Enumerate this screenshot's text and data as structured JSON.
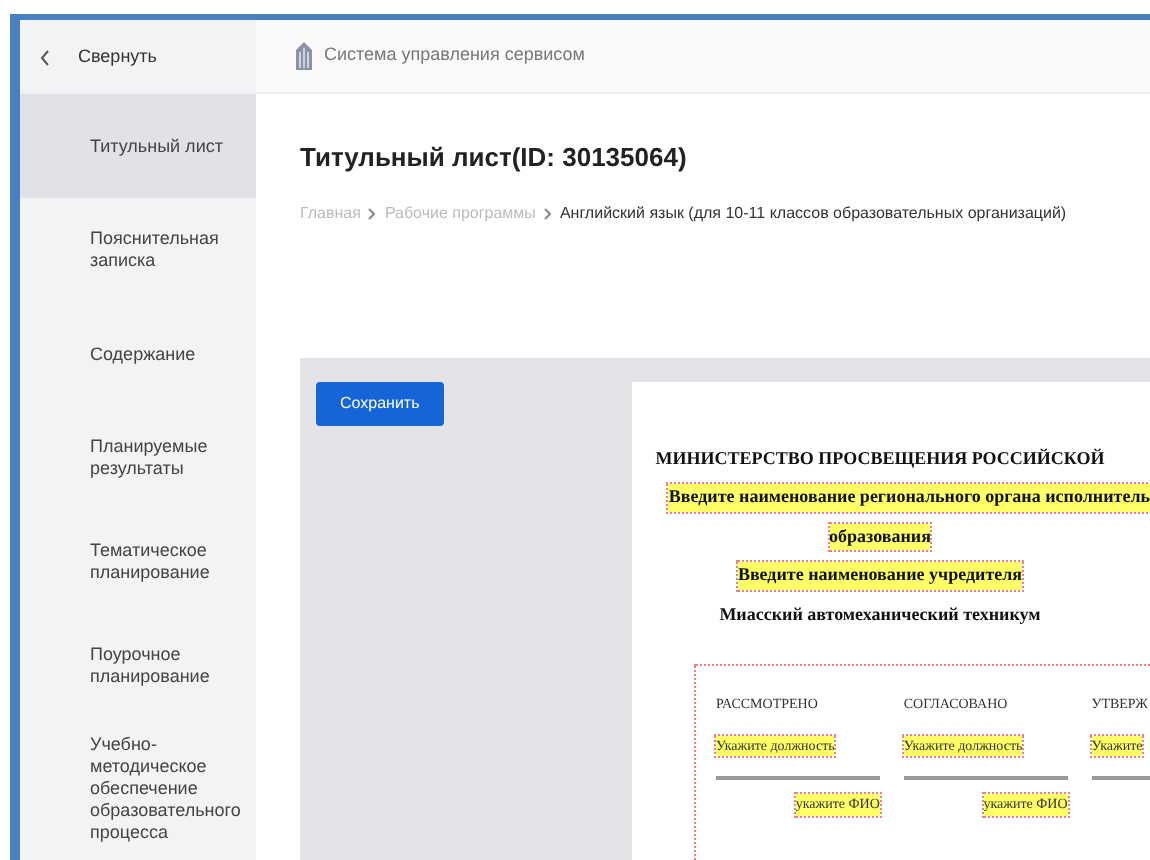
{
  "sidebar": {
    "collapse_label": "Свернуть",
    "items": [
      {
        "label": "Титульный лист",
        "selected": true
      },
      {
        "label": "Пояснительная записка",
        "selected": false
      },
      {
        "label": "Содержание",
        "selected": false
      },
      {
        "label": "Планируемые результаты",
        "selected": false
      },
      {
        "label": "Тематическое планирование",
        "selected": false
      },
      {
        "label": "Поурочное планирование",
        "selected": false
      },
      {
        "label": "Учебно-методическое обеспечение образовательного процесса",
        "selected": false
      }
    ]
  },
  "header": {
    "title": "Система управления сервисом"
  },
  "page": {
    "title": "Титульный лист(ID: 30135064)",
    "breadcrumbs": [
      {
        "label": "Главная",
        "current": false
      },
      {
        "label": "Рабочие программы",
        "current": false
      },
      {
        "label": "Английский язык (для 10-11 классов образовательных организаций)",
        "current": true
      }
    ]
  },
  "save_button": "Сохранить",
  "document": {
    "lines": [
      {
        "text": "МИНИСТЕРСТВО ПРОСВЕЩЕНИЯ РОССИЙСКОЙ",
        "placeholder": false
      },
      {
        "text": "Введите наименование регионального органа исполнитель",
        "placeholder": true
      },
      {
        "text": "образования",
        "placeholder": true
      },
      {
        "text": "Введите наименование учредителя",
        "placeholder": true
      },
      {
        "text": "Миасский автомеханический техникум",
        "placeholder": false
      }
    ],
    "approvals": [
      {
        "heading": "РАССМОТРЕНО",
        "position": "Укажите должность",
        "name": "укажите ФИО"
      },
      {
        "heading": "СОГЛАСОВАНО",
        "position": "Укажите должность",
        "name": "укажите ФИО"
      },
      {
        "heading": "УТВЕРЖ",
        "position": "Укажите"
      }
    ]
  }
}
